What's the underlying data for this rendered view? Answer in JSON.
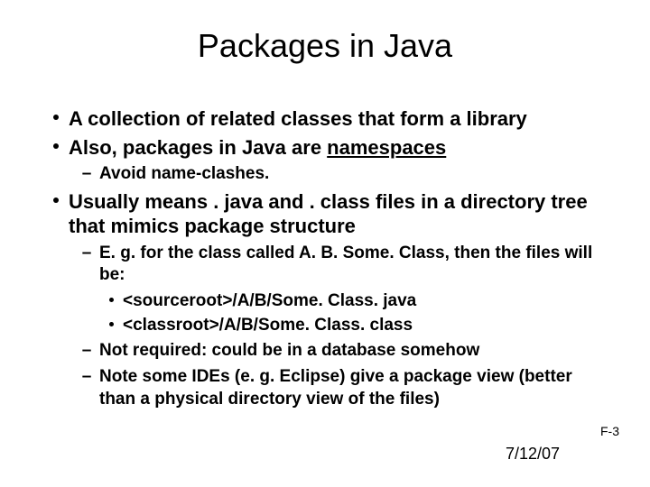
{
  "title": "Packages in Java",
  "bullets": {
    "b1": "A collection of related classes that form a library",
    "b2_pre": "Also, packages in Java are ",
    "b2_u": "namespaces",
    "b2_1": "Avoid name-clashes.",
    "b3": "Usually means . java and . class files in a directory tree that mimics package structure",
    "b3_1": "E. g. for the class called A. B. Some. Class, then the files will be:",
    "b3_1_1": "<sourceroot>/A/B/Some. Class. java",
    "b3_1_2": "<classroot>/A/B/Some. Class. class",
    "b3_2": "Not required: could be in a database somehow",
    "b3_3": "Note some IDEs (e. g. Eclipse) give a package view (better than a physical directory view of the files)"
  },
  "page_num": "F-3",
  "date": "7/12/07"
}
